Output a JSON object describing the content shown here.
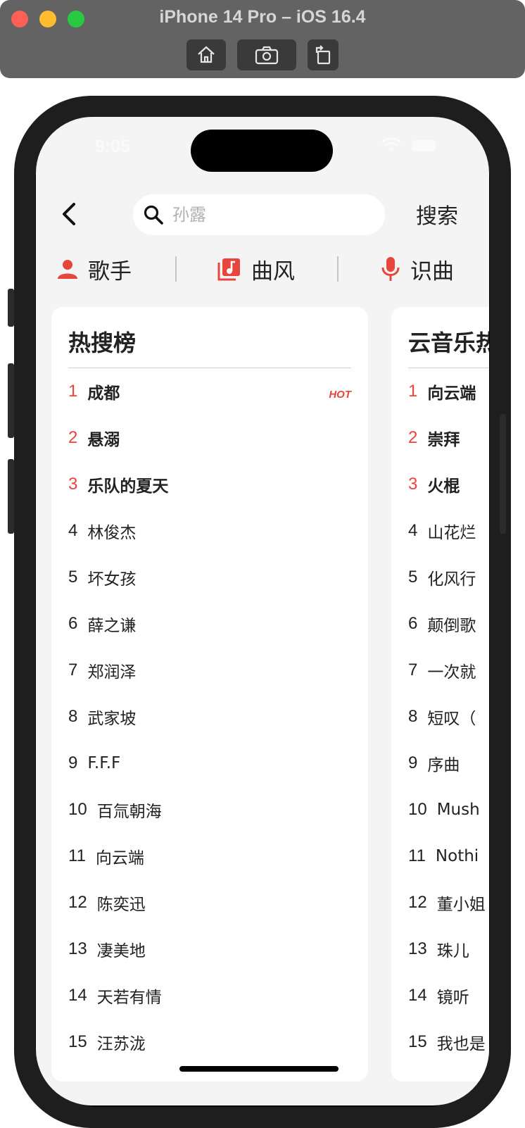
{
  "simulator": {
    "title": "iPhone 14 Pro – iOS 16.4",
    "buttons": [
      "home-icon",
      "screenshot-icon",
      "rotate-icon"
    ]
  },
  "status_bar": {
    "time": "9:05"
  },
  "header": {
    "back_icon": "chevron-left-icon",
    "search_placeholder": "孙露",
    "search_button": "搜索"
  },
  "categories": [
    {
      "label": "歌手",
      "icon": "person-icon"
    },
    {
      "label": "曲风",
      "icon": "music-library-icon"
    },
    {
      "label": "识曲",
      "icon": "microphone-icon"
    }
  ],
  "colors": {
    "accent": "#e8453c",
    "background": "#f4f4f4",
    "card": "#ffffff"
  },
  "hot_list": {
    "title": "热搜榜",
    "hot_badge": "HOT",
    "items": [
      {
        "rank": "1",
        "name": "成都"
      },
      {
        "rank": "2",
        "name": "悬溺"
      },
      {
        "rank": "3",
        "name": "乐队的夏天"
      },
      {
        "rank": "4",
        "name": "林俊杰"
      },
      {
        "rank": "5",
        "name": "坏女孩"
      },
      {
        "rank": "6",
        "name": "薛之谦"
      },
      {
        "rank": "7",
        "name": "郑润泽"
      },
      {
        "rank": "8",
        "name": "武家坡"
      },
      {
        "rank": "9",
        "name": "F.F.F"
      },
      {
        "rank": "10",
        "name": "百氚朝海"
      },
      {
        "rank": "11",
        "name": "向云端"
      },
      {
        "rank": "12",
        "name": "陈奕迅"
      },
      {
        "rank": "13",
        "name": "凄美地"
      },
      {
        "rank": "14",
        "name": "天若有情"
      },
      {
        "rank": "15",
        "name": "汪苏泷"
      }
    ]
  },
  "music_list": {
    "title": "云音乐热",
    "items": [
      {
        "rank": "1",
        "name": "向云端"
      },
      {
        "rank": "2",
        "name": "崇拜"
      },
      {
        "rank": "3",
        "name": "火棍"
      },
      {
        "rank": "4",
        "name": "山花烂"
      },
      {
        "rank": "5",
        "name": "化风行"
      },
      {
        "rank": "6",
        "name": "颠倒歌"
      },
      {
        "rank": "7",
        "name": "一次就"
      },
      {
        "rank": "8",
        "name": "短叹（"
      },
      {
        "rank": "9",
        "name": "序曲"
      },
      {
        "rank": "10",
        "name": "Mush"
      },
      {
        "rank": "11",
        "name": "Nothi"
      },
      {
        "rank": "12",
        "name": "董小姐"
      },
      {
        "rank": "13",
        "name": "珠儿"
      },
      {
        "rank": "14",
        "name": "镜听"
      },
      {
        "rank": "15",
        "name": "我也是"
      }
    ]
  }
}
